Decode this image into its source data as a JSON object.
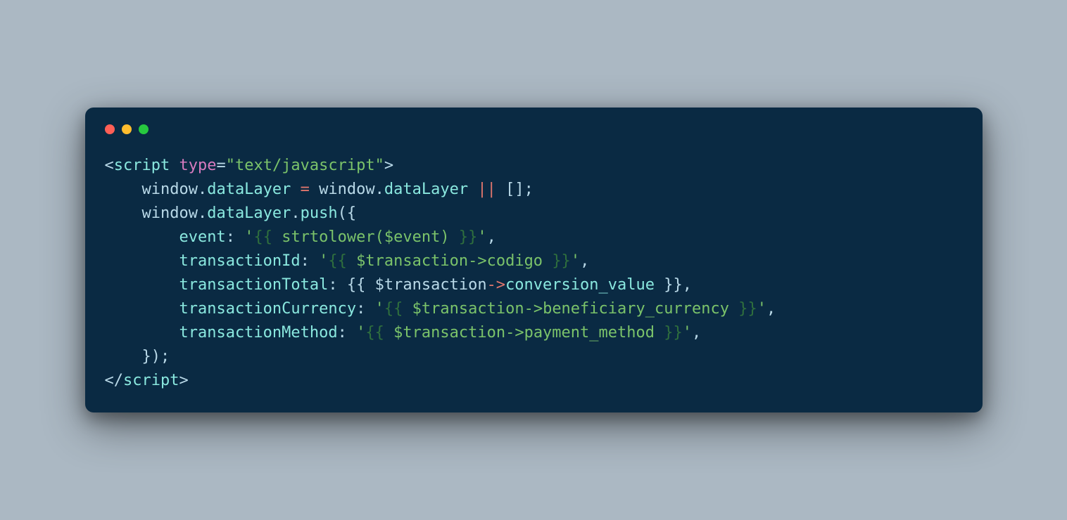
{
  "window": {
    "titlebar_dots": [
      "red",
      "yellow",
      "green"
    ]
  },
  "code": {
    "tokens": [
      {
        "cls": "t-default",
        "text": "<"
      },
      {
        "cls": "t-tag",
        "text": "script"
      },
      {
        "cls": "t-default",
        "text": " "
      },
      {
        "cls": "t-attr",
        "text": "type"
      },
      {
        "cls": "t-default",
        "text": "="
      },
      {
        "cls": "t-str",
        "text": "\"text/javascript\""
      },
      {
        "cls": "t-default",
        "text": ">"
      },
      {
        "cls": "",
        "text": "\n"
      },
      {
        "cls": "t-default",
        "text": "    window"
      },
      {
        "cls": "t-default",
        "text": "."
      },
      {
        "cls": "t-tag",
        "text": "dataLayer"
      },
      {
        "cls": "t-default",
        "text": " "
      },
      {
        "cls": "t-op",
        "text": "="
      },
      {
        "cls": "t-default",
        "text": " window"
      },
      {
        "cls": "t-default",
        "text": "."
      },
      {
        "cls": "t-tag",
        "text": "dataLayer"
      },
      {
        "cls": "t-default",
        "text": " "
      },
      {
        "cls": "t-op",
        "text": "||"
      },
      {
        "cls": "t-default",
        "text": " [];"
      },
      {
        "cls": "",
        "text": "\n"
      },
      {
        "cls": "t-default",
        "text": "    window"
      },
      {
        "cls": "t-default",
        "text": "."
      },
      {
        "cls": "t-tag",
        "text": "dataLayer"
      },
      {
        "cls": "t-default",
        "text": "."
      },
      {
        "cls": "t-tag",
        "text": "push"
      },
      {
        "cls": "t-default",
        "text": "({"
      },
      {
        "cls": "",
        "text": "\n"
      },
      {
        "cls": "t-default",
        "text": "        "
      },
      {
        "cls": "t-tag",
        "text": "event"
      },
      {
        "cls": "t-default",
        "text": ": "
      },
      {
        "cls": "t-str",
        "text": "'"
      },
      {
        "cls": "t-strbr",
        "text": "{{"
      },
      {
        "cls": "t-str",
        "text": " strtolower($event) "
      },
      {
        "cls": "t-strbr",
        "text": "}}"
      },
      {
        "cls": "t-str",
        "text": "'"
      },
      {
        "cls": "t-default",
        "text": ","
      },
      {
        "cls": "",
        "text": "\n"
      },
      {
        "cls": "t-default",
        "text": "        "
      },
      {
        "cls": "t-tag",
        "text": "transactionId"
      },
      {
        "cls": "t-default",
        "text": ": "
      },
      {
        "cls": "t-str",
        "text": "'"
      },
      {
        "cls": "t-strbr",
        "text": "{{"
      },
      {
        "cls": "t-str",
        "text": " $transaction->codigo "
      },
      {
        "cls": "t-strbr",
        "text": "}}"
      },
      {
        "cls": "t-str",
        "text": "'"
      },
      {
        "cls": "t-default",
        "text": ","
      },
      {
        "cls": "",
        "text": "\n"
      },
      {
        "cls": "t-default",
        "text": "        "
      },
      {
        "cls": "t-tag",
        "text": "transactionTotal"
      },
      {
        "cls": "t-default",
        "text": ": {{ $transaction"
      },
      {
        "cls": "t-op",
        "text": "->"
      },
      {
        "cls": "t-tag",
        "text": "conversion_value"
      },
      {
        "cls": "t-default",
        "text": " }},"
      },
      {
        "cls": "",
        "text": "\n"
      },
      {
        "cls": "t-default",
        "text": "        "
      },
      {
        "cls": "t-tag",
        "text": "transactionCurrency"
      },
      {
        "cls": "t-default",
        "text": ": "
      },
      {
        "cls": "t-str",
        "text": "'"
      },
      {
        "cls": "t-strbr",
        "text": "{{"
      },
      {
        "cls": "t-str",
        "text": " $transaction->beneficiary_currency "
      },
      {
        "cls": "t-strbr",
        "text": "}}"
      },
      {
        "cls": "t-str",
        "text": "'"
      },
      {
        "cls": "t-default",
        "text": ","
      },
      {
        "cls": "",
        "text": "\n"
      },
      {
        "cls": "t-default",
        "text": "        "
      },
      {
        "cls": "t-tag",
        "text": "transactionMethod"
      },
      {
        "cls": "t-default",
        "text": ": "
      },
      {
        "cls": "t-str",
        "text": "'"
      },
      {
        "cls": "t-strbr",
        "text": "{{"
      },
      {
        "cls": "t-str",
        "text": " $transaction->payment_method "
      },
      {
        "cls": "t-strbr",
        "text": "}}"
      },
      {
        "cls": "t-str",
        "text": "'"
      },
      {
        "cls": "t-default",
        "text": ","
      },
      {
        "cls": "",
        "text": "\n"
      },
      {
        "cls": "t-default",
        "text": "    });"
      },
      {
        "cls": "",
        "text": "\n"
      },
      {
        "cls": "t-default",
        "text": "</"
      },
      {
        "cls": "t-tag",
        "text": "script"
      },
      {
        "cls": "t-default",
        "text": ">"
      }
    ]
  }
}
